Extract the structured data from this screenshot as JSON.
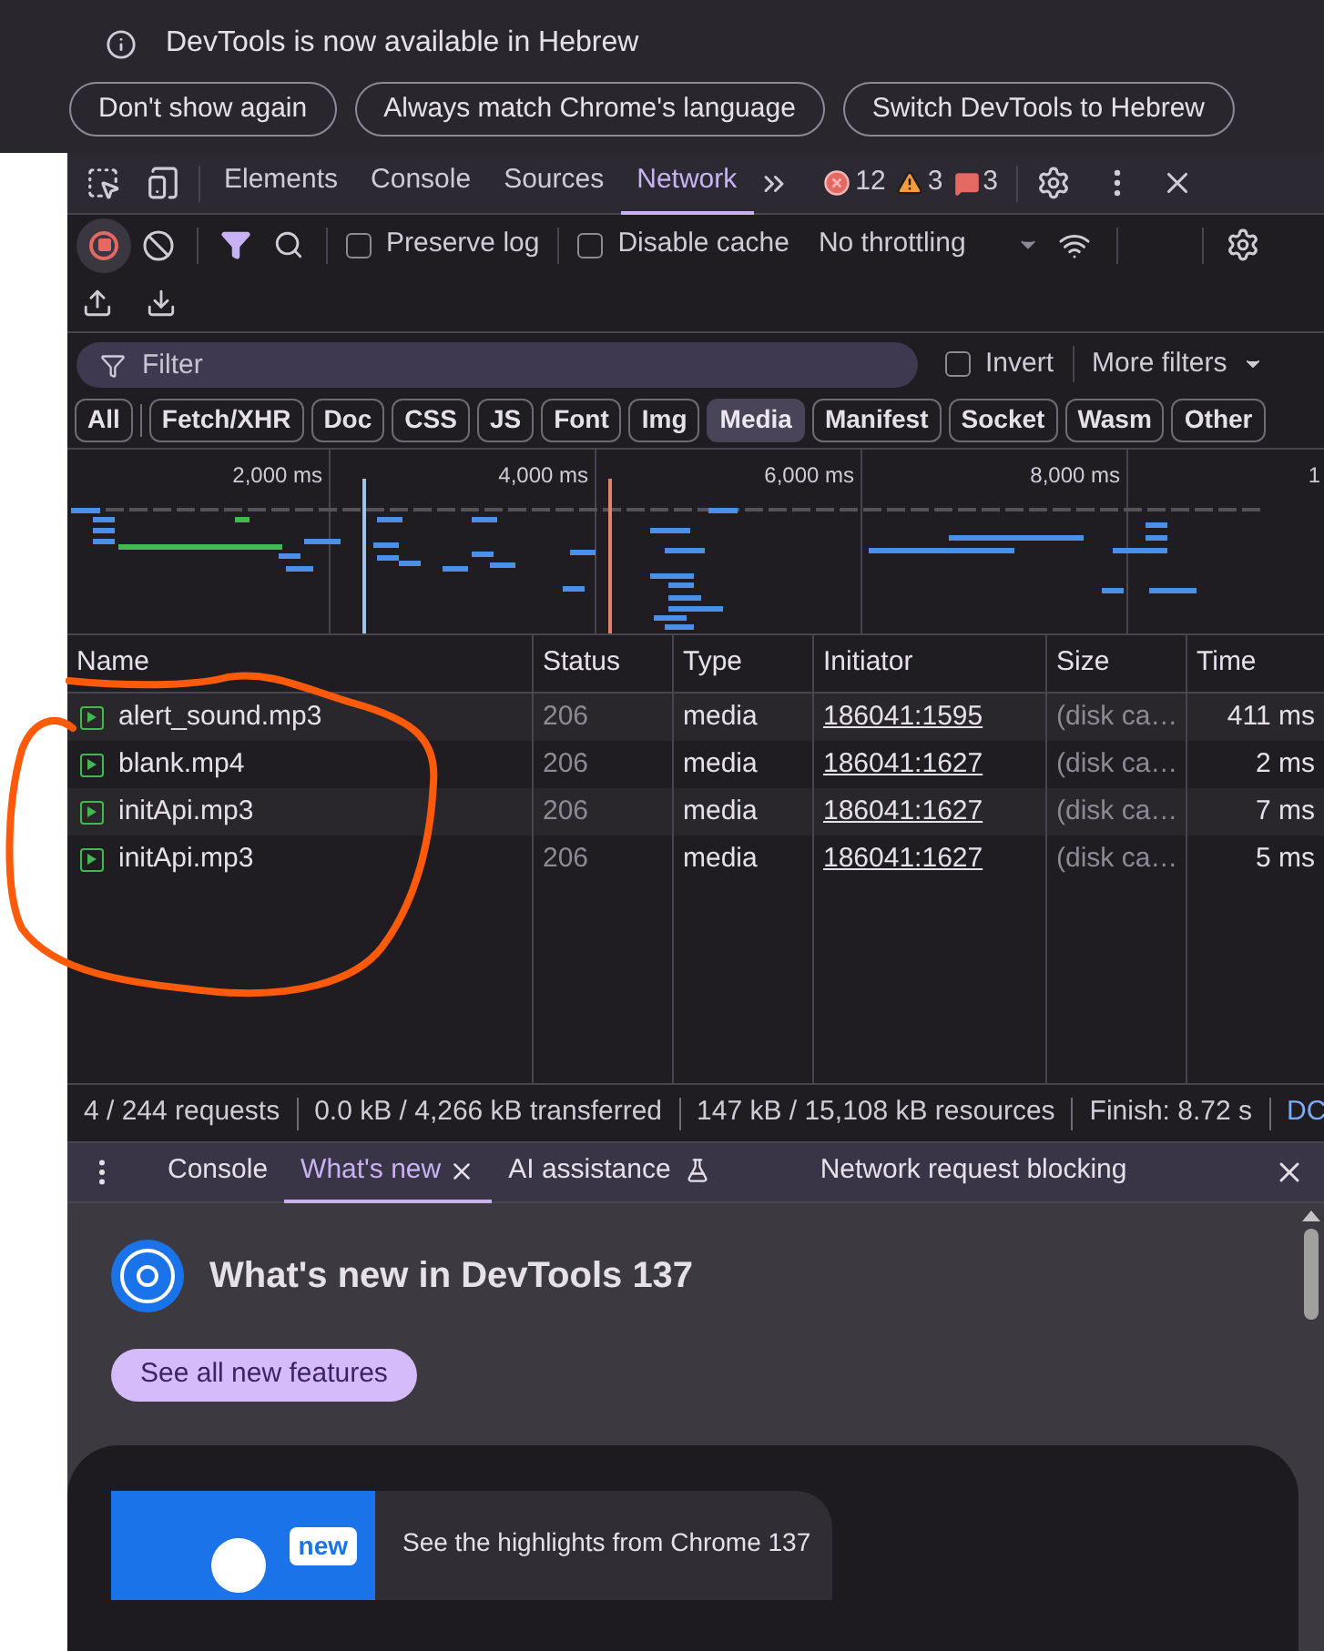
{
  "infobar": {
    "message": "DevTools is now available in Hebrew",
    "buttons": [
      "Don't show again",
      "Always match Chrome's language",
      "Switch DevTools to Hebrew"
    ]
  },
  "panel_tabs": [
    {
      "label": "Elements",
      "selected": false
    },
    {
      "label": "Console",
      "selected": false
    },
    {
      "label": "Sources",
      "selected": false
    },
    {
      "label": "Network",
      "selected": true
    }
  ],
  "issues": {
    "errors": "12",
    "warnings": "3",
    "info": "3"
  },
  "toolbar": {
    "recording": true,
    "preserve_log": {
      "label": "Preserve log",
      "checked": false
    },
    "disable_cache": {
      "label": "Disable cache",
      "checked": false
    },
    "throttling": "No throttling"
  },
  "filter": {
    "placeholder": "Filter",
    "invert": {
      "label": "Invert",
      "checked": false
    },
    "more_filters": "More filters"
  },
  "type_filters": [
    {
      "label": "All",
      "selected": false
    },
    {
      "label": "Fetch/XHR",
      "selected": false
    },
    {
      "label": "Doc",
      "selected": false
    },
    {
      "label": "CSS",
      "selected": false
    },
    {
      "label": "JS",
      "selected": false
    },
    {
      "label": "Font",
      "selected": false
    },
    {
      "label": "Img",
      "selected": false
    },
    {
      "label": "Media",
      "selected": true
    },
    {
      "label": "Manifest",
      "selected": false
    },
    {
      "label": "Socket",
      "selected": false
    },
    {
      "label": "Wasm",
      "selected": false
    },
    {
      "label": "Other",
      "selected": false
    }
  ],
  "timeline": {
    "ticks": [
      "2,000 ms",
      "4,000 ms",
      "6,000 ms",
      "8,000 ms",
      "1"
    ]
  },
  "table": {
    "columns": [
      "Name",
      "Status",
      "Type",
      "Initiator",
      "Size",
      "Time"
    ],
    "rows": [
      {
        "name": "alert_sound.mp3",
        "status": "206",
        "type": "media",
        "initiator": "186041:1595",
        "size": "(disk ca…",
        "time": "411 ms"
      },
      {
        "name": "blank.mp4",
        "status": "206",
        "type": "media",
        "initiator": "186041:1627",
        "size": "(disk ca…",
        "time": "2 ms"
      },
      {
        "name": "initApi.mp3",
        "status": "206",
        "type": "media",
        "initiator": "186041:1627",
        "size": "(disk ca…",
        "time": "7 ms"
      },
      {
        "name": "initApi.mp3",
        "status": "206",
        "type": "media",
        "initiator": "186041:1627",
        "size": "(disk ca…",
        "time": "5 ms"
      }
    ]
  },
  "status_bar": [
    {
      "text": "4 / 244 requests",
      "kind": "stat"
    },
    {
      "text": "0.0 kB / 4,266 kB transferred",
      "kind": "stat"
    },
    {
      "text": "147 kB / 15,108 kB resources",
      "kind": "stat"
    },
    {
      "text": "Finish: 8.72 s",
      "kind": "stat"
    },
    {
      "text": "DC",
      "kind": "link"
    }
  ],
  "drawer": {
    "tabs": [
      {
        "label": "Console",
        "selected": false,
        "closable": false,
        "experimental": false
      },
      {
        "label": "What's new",
        "selected": true,
        "closable": true,
        "experimental": false
      },
      {
        "label": "AI assistance",
        "selected": false,
        "closable": false,
        "experimental": true
      },
      {
        "label": "Network request blocking",
        "selected": false,
        "closable": false,
        "experimental": false
      }
    ]
  },
  "whats_new": {
    "title": "What's new in DevTools 137",
    "button": "See all new features",
    "video": {
      "badge": "new",
      "caption": "See the highlights from Chrome 137"
    }
  }
}
